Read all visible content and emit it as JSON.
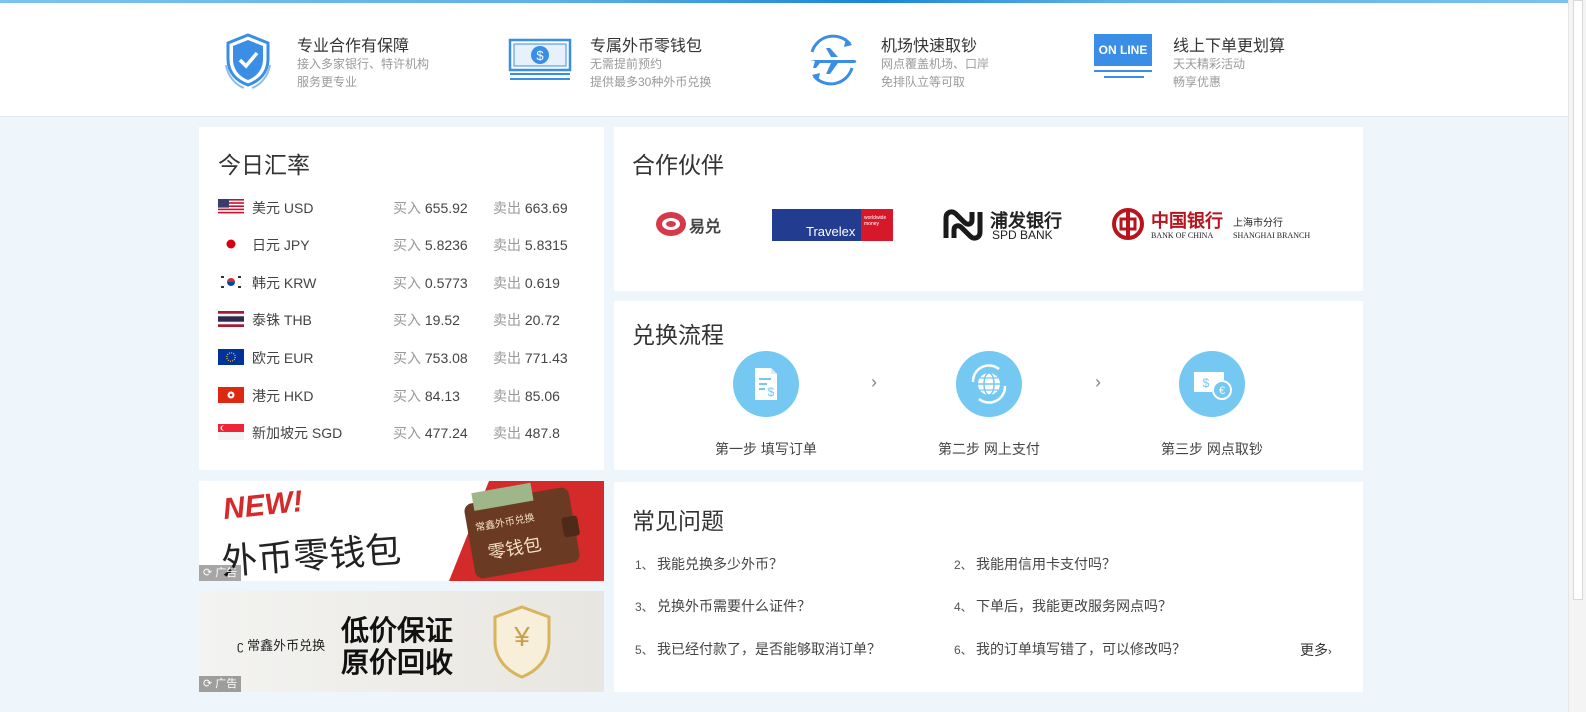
{
  "features": [
    {
      "icon": "shield-icon",
      "title": "专业合作有保障",
      "desc": [
        "接入多家银行、特许机构",
        "服务更专业"
      ]
    },
    {
      "icon": "wallet-money-icon",
      "title": "专属外币零钱包",
      "desc": [
        "无需提前预约",
        "提供最多30种外币兑换"
      ]
    },
    {
      "icon": "airport-plane-icon",
      "title": "机场快速取钞",
      "desc": [
        "网点覆盖机场、口岸",
        "免排队立等可取"
      ]
    },
    {
      "icon": "online-monitor-icon",
      "title": "线上下单更划算",
      "desc": [
        "天天精彩活动",
        "畅享优惠"
      ],
      "badge": "ON LINE"
    }
  ],
  "rates": {
    "title": "今日汇率",
    "buy_label": "买入",
    "sell_label": "卖出",
    "items": [
      {
        "flag": "us-flag-icon",
        "name": "美元 USD",
        "buy": "655.92",
        "sell": "663.69"
      },
      {
        "flag": "jp-flag-icon",
        "name": "日元 JPY",
        "buy": "5.8236",
        "sell": "5.8315"
      },
      {
        "flag": "kr-flag-icon",
        "name": "韩元 KRW",
        "buy": "0.5773",
        "sell": "0.619"
      },
      {
        "flag": "th-flag-icon",
        "name": "泰铢 THB",
        "buy": "19.52",
        "sell": "20.72"
      },
      {
        "flag": "eu-flag-icon",
        "name": "欧元 EUR",
        "buy": "753.08",
        "sell": "771.43"
      },
      {
        "flag": "hk-flag-icon",
        "name": "港元 HKD",
        "buy": "84.13",
        "sell": "85.06"
      },
      {
        "flag": "sg-flag-icon",
        "name": "新加坡元 SGD",
        "buy": "477.24",
        "sell": "487.8"
      }
    ]
  },
  "ads": [
    {
      "new_text": "NEW!",
      "headline": "外币零钱包",
      "wallet_brand": "常鑫外币兑换",
      "wallet_text": "零钱包",
      "tag": "广告"
    },
    {
      "brand": "常鑫外币兑换",
      "line1": "低价保证",
      "line2": "原价回收",
      "symbol": "¥",
      "tag": "广告"
    }
  ],
  "partners": {
    "title": "合作伙伴",
    "items": [
      {
        "name": "易兑",
        "icon": "yidui-logo-icon"
      },
      {
        "name": "Travelex",
        "sub": "worldwide money",
        "icon": "travelex-logo-icon"
      },
      {
        "name": "浦发银行",
        "sub": "SPD BANK",
        "icon": "spdb-logo-icon"
      },
      {
        "name": "中国银行",
        "sub": "BANK OF CHINA",
        "branch": "上海市分行",
        "branch_en": "SHANGHAI BRANCH",
        "icon": "boc-logo-icon"
      }
    ]
  },
  "process": {
    "title": "兑换流程",
    "steps": [
      {
        "icon": "form-document-icon",
        "label": "第一步 填写订单"
      },
      {
        "icon": "online-pay-globe-icon",
        "label": "第二步 网上支付"
      },
      {
        "icon": "cash-pickup-icon",
        "label": "第三步 网点取钞"
      }
    ]
  },
  "faq": {
    "title": "常见问题",
    "items": [
      {
        "num": "1、",
        "q": "我能兑换多少外币？"
      },
      {
        "num": "2、",
        "q": "我能用信用卡支付吗？"
      },
      {
        "num": "3、",
        "q": "兑换外币需要什么证件？"
      },
      {
        "num": "4、",
        "q": "下单后，我能更改服务网点吗？"
      },
      {
        "num": "5、",
        "q": "我已经付款了，是否能够取消订单？"
      },
      {
        "num": "6、",
        "q": "我的订单填写错了，可以修改吗？"
      }
    ],
    "more": "更多",
    "more_arrow": "›"
  },
  "colors": {
    "accent": "#3a8ee6",
    "step_circle": "#74c8f2",
    "background": "#eef6fb"
  }
}
